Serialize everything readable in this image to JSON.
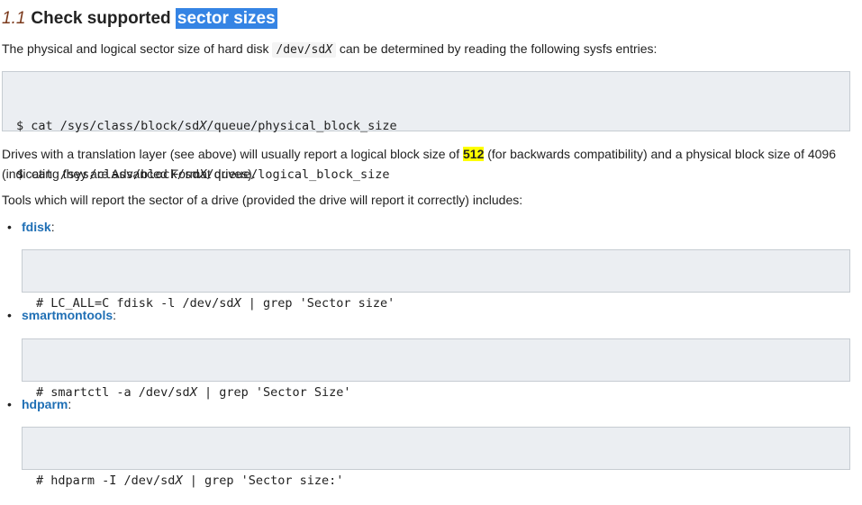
{
  "heading": {
    "number": "1.1",
    "title": "Check supported",
    "selected": "sector sizes"
  },
  "intro": {
    "before": "The physical and logical sector size of hard disk",
    "code": "/dev/sd",
    "code_var": "X",
    "after": "can be determined by reading the following sysfs entries:"
  },
  "sysfs_block": {
    "line1_a": "$ cat /sys/class/block/sd",
    "line1_var": "X",
    "line1_b": "/queue/physical_block_size",
    "line2_a": "$ cat /sys/class/block/sd",
    "line2_var": "X",
    "line2_b": "/queue/logical_block_size"
  },
  "drives_para": {
    "before": "Drives with a translation layer (see above) will usually report a logical block size of",
    "highlight": "512",
    "after": "(for backwards compatibility) and a physical block size of 4096 (indicating they are Advanced Format drives)."
  },
  "tools_para": "Tools which will report the sector of a drive (provided the drive will report it correctly) includes:",
  "tools": [
    {
      "bullet": "•",
      "name": "fdisk",
      "suffix": ":",
      "cmd_a": "# LC_ALL=C fdisk -l /dev/sd",
      "cmd_var": "X",
      "cmd_b": " | grep 'Sector size'"
    },
    {
      "bullet": "•",
      "name": "smartmontools",
      "suffix": ":",
      "cmd_a": "# smartctl -a /dev/sd",
      "cmd_var": "X",
      "cmd_b": " | grep 'Sector Size'"
    },
    {
      "bullet": "•",
      "name": "hdparm",
      "suffix": ":",
      "cmd_a": "# hdparm -I /dev/sd",
      "cmd_var": "X",
      "cmd_b": " | grep 'Sector size:'"
    }
  ],
  "colors": {
    "link": "#1f6fb5",
    "selection": "#3584e4",
    "highlight": "#ffff00",
    "code_bg": "#ebeef2"
  }
}
